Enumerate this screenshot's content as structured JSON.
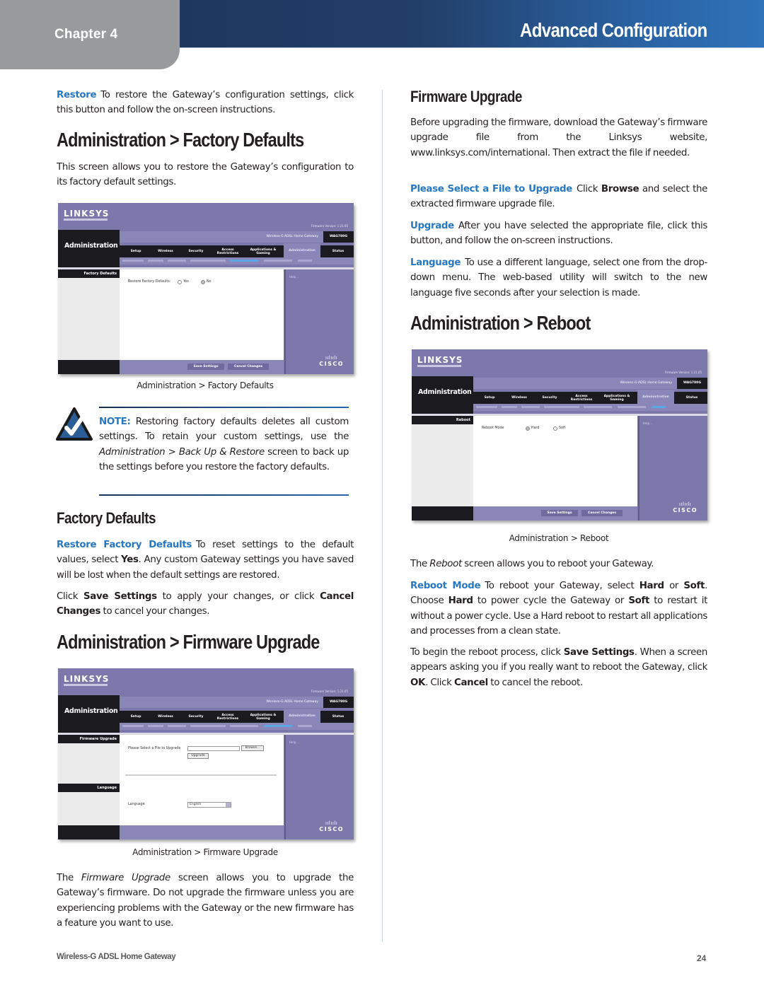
{
  "header": {
    "chapter": "Chapter 4",
    "title": "Advanced Configuration"
  },
  "left": {
    "restore": {
      "term": "Restore",
      "text": "To restore the Gateway’s configuration settings, click this button and follow the on-screen instructions."
    },
    "factory_heading": "Administration > Factory Defaults",
    "factory_intro": "This screen allows you to restore the Gateway’s configuration to its factory default settings.",
    "factory_caption": "Administration > Factory Defaults",
    "note": {
      "label": "NOTE:",
      "text_before": "Restoring factory defaults deletes all custom settings. To retain your custom settings, use the",
      "italic": "Administration > Back Up & Restore",
      "text_after": "screen to back up the settings before you restore the factory defaults."
    },
    "factory_subheading": "Factory Defaults",
    "restore_factory": {
      "term": "Restore Factory Defaults",
      "text_1": "To reset settings to the default values, select",
      "bold_yes": "Yes",
      "text_2": ". Any custom Gateway settings you have saved will be lost when the default settings are restored."
    },
    "save_para": {
      "t1": "Click",
      "b1": "Save Settings",
      "t2": "to apply your changes, or click",
      "b2": "Cancel Changes",
      "t3": "to cancel your changes."
    },
    "firmware_heading": "Administration > Firmware Upgrade",
    "firmware_caption": "Administration > Firmware Upgrade",
    "firmware_intro": {
      "t1": "The",
      "i1": "Firmware Upgrade",
      "t2": "screen allows you to upgrade the Gateway’s firmware. Do not upgrade the firmware unless you are experiencing problems with the Gateway or the new firmware has a feature you want to use."
    }
  },
  "right": {
    "firmware_subheading": "Firmware Upgrade",
    "firmware_para": "Before upgrading the firmware, download the Gateway’s firmware upgrade file from the Linksys website, www.linksys.com/international. Then extract the file if needed.",
    "select_file": {
      "term": "Please Select a File to Upgrade",
      "t1": "Click",
      "b1": "Browse",
      "t2": "and select the extracted firmware upgrade file."
    },
    "upgrade": {
      "term": "Upgrade",
      "text": "After you have selected the appropriate file, click this button, and follow the on-screen instructions."
    },
    "language": {
      "term": "Language",
      "text": "To use a different language, select one from the drop-down menu. The web-based utility will switch to the new language five seconds after your selection is made."
    },
    "reboot_heading": "Administration > Reboot",
    "reboot_caption": "Administration > Reboot",
    "reboot_intro": {
      "t1": "The",
      "i1": "Reboot",
      "t2": "screen allows you to reboot your Gateway."
    },
    "reboot_mode": {
      "term": "Reboot Mode",
      "t1": "To reboot your Gateway, select",
      "b1": "Hard",
      "t2": "or",
      "b2": "Soft",
      "t3": ". Choose",
      "b3": "Hard",
      "t4": "to power cycle the Gateway or",
      "b4": "Soft",
      "t5": "to restart it without a power cycle. Use a Hard reboot to restart all applications and processes from a clean state."
    },
    "reboot_begin": {
      "t1": "To begin the reboot process, click",
      "b1": "Save Settings",
      "t2": ". When a screen appears asking you if you really want to reboot the Gateway, click",
      "b2": "OK",
      "t3": ". Click",
      "b3": "Cancel",
      "t4": "to cancel the reboot."
    }
  },
  "router_ui": {
    "logo": "LINKSYS",
    "section": "Administration",
    "product": "Wireless-G ADSL Home Gateway",
    "model": "WAG780G",
    "firmware_version": "Firmware Version: 1.21.05",
    "help": "Help...",
    "tabs": [
      "Setup",
      "Wireless",
      "Security",
      "Access Restrictions",
      "Applications & Gaming",
      "Administration",
      "Status"
    ],
    "cisco": "CISCO",
    "save_button": "Save Settings",
    "cancel_button": "Cancel Changes",
    "factory": {
      "side_label": "Factory Defaults",
      "field_label": "Restore Factory Defaults:",
      "opt_yes": "Yes",
      "opt_no": "No",
      "selected": "No"
    },
    "firmware": {
      "side_label": "Firmware Upgrade",
      "field_label": "Please Select a File to Upgrade",
      "browse": "Browse...",
      "upgrade": "Upgrade",
      "lang_side_label": "Language",
      "lang_label": "Language",
      "lang_value": "English"
    },
    "reboot": {
      "side_label": "Reboot",
      "field_label": "Reboot Mode",
      "opt_hard": "Hard",
      "opt_soft": "Soft",
      "selected": "Hard"
    }
  },
  "footer": {
    "product": "Wireless-G ADSL Home Gateway",
    "page": "24"
  },
  "colors": {
    "accent_blue": "#2878c0",
    "header_dark": "#1c3157",
    "header_light": "#2f72b8",
    "chapter_gray": "#999a9c",
    "router_purple": "#7c78ab"
  }
}
